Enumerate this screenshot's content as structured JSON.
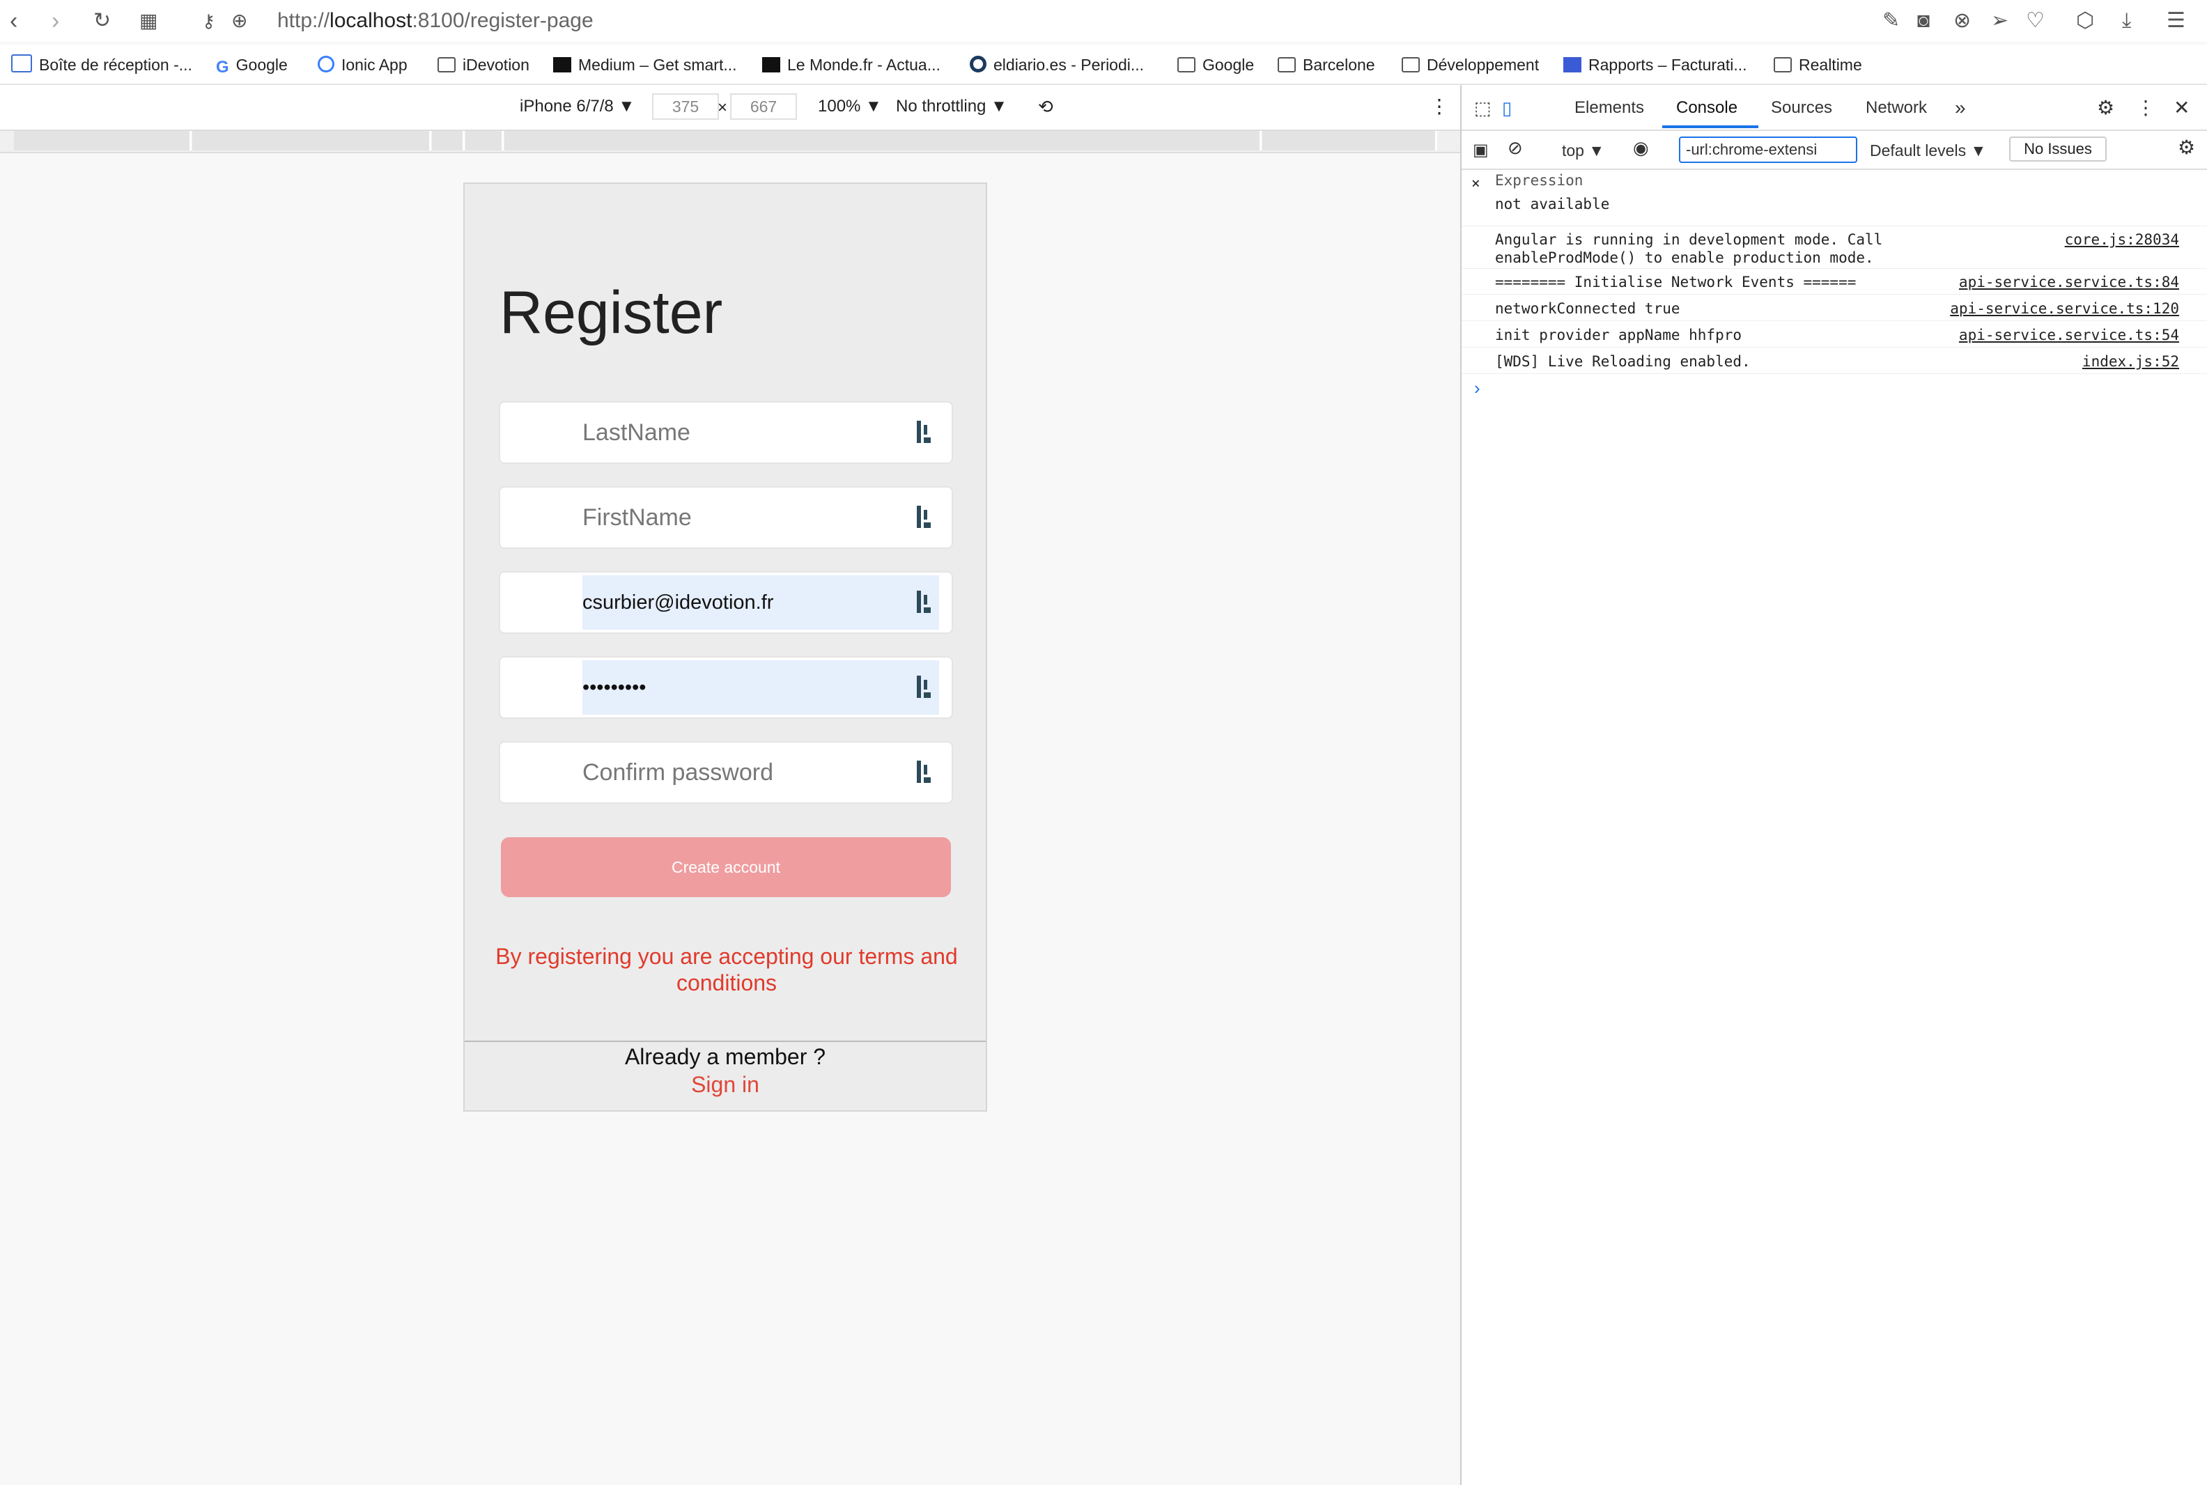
{
  "browser": {
    "url_scheme_host_prefix": "http://",
    "url_host": "localhost",
    "url_rest": ":8100/register-page"
  },
  "bookmarks": [
    "Boîte de réception -...",
    "Google",
    "Ionic App",
    "iDevotion",
    "Medium – Get smart...",
    "Le Monde.fr - Actua...",
    "eldiario.es - Periodi...",
    "Google",
    "Barcelone",
    "Développement",
    "Rapports – Facturati...",
    "Realtime"
  ],
  "device_toolbar": {
    "device": "iPhone 6/7/8 ▼",
    "width": "375",
    "times": "×",
    "height": "667",
    "zoom": "100% ▼",
    "throttle": "No throttling ▼"
  },
  "page": {
    "title": "Register",
    "fields": [
      {
        "name": "lastname",
        "value": "LastName",
        "filled": false
      },
      {
        "name": "firstname",
        "value": "FirstName",
        "filled": false
      },
      {
        "name": "email",
        "value": "csurbier@idevotion.fr",
        "filled": true
      },
      {
        "name": "password",
        "value": "•••••••••",
        "filled": true
      },
      {
        "name": "confirm-password",
        "value": "Confirm password",
        "filled": false
      }
    ],
    "create_button": "Create account",
    "terms": "By registering you are accepting our terms and conditions",
    "already_member": "Already a member ?",
    "sign_in": "Sign in"
  },
  "devtools": {
    "tabs": [
      "Elements",
      "Console",
      "Sources",
      "Network"
    ],
    "more": "»",
    "context": "top ▼",
    "filter": "-url:chrome-extensi",
    "levels": "Default levels ▼",
    "issues": "No Issues",
    "expression_label": "Expression",
    "expression_value": "not available",
    "logs": [
      {
        "msg": "Angular is running in development mode. Call\nenableProdMode() to enable production mode.",
        "src": "core.js:28034"
      },
      {
        "msg": "======== Initialise Network Events ======",
        "src": "api-service.service.ts:84"
      },
      {
        "msg": "networkConnected true",
        "src": "api-service.service.ts:120"
      },
      {
        "msg": "init provider appName hhfpro",
        "src": "api-service.service.ts:54"
      },
      {
        "msg": "[WDS] Live Reloading enabled.",
        "src": "index.js:52"
      }
    ],
    "prompt": "›"
  },
  "colors": {
    "accent": "#e0473a",
    "button": "#ef9d9f",
    "devtools_active": "#1a73e8"
  }
}
